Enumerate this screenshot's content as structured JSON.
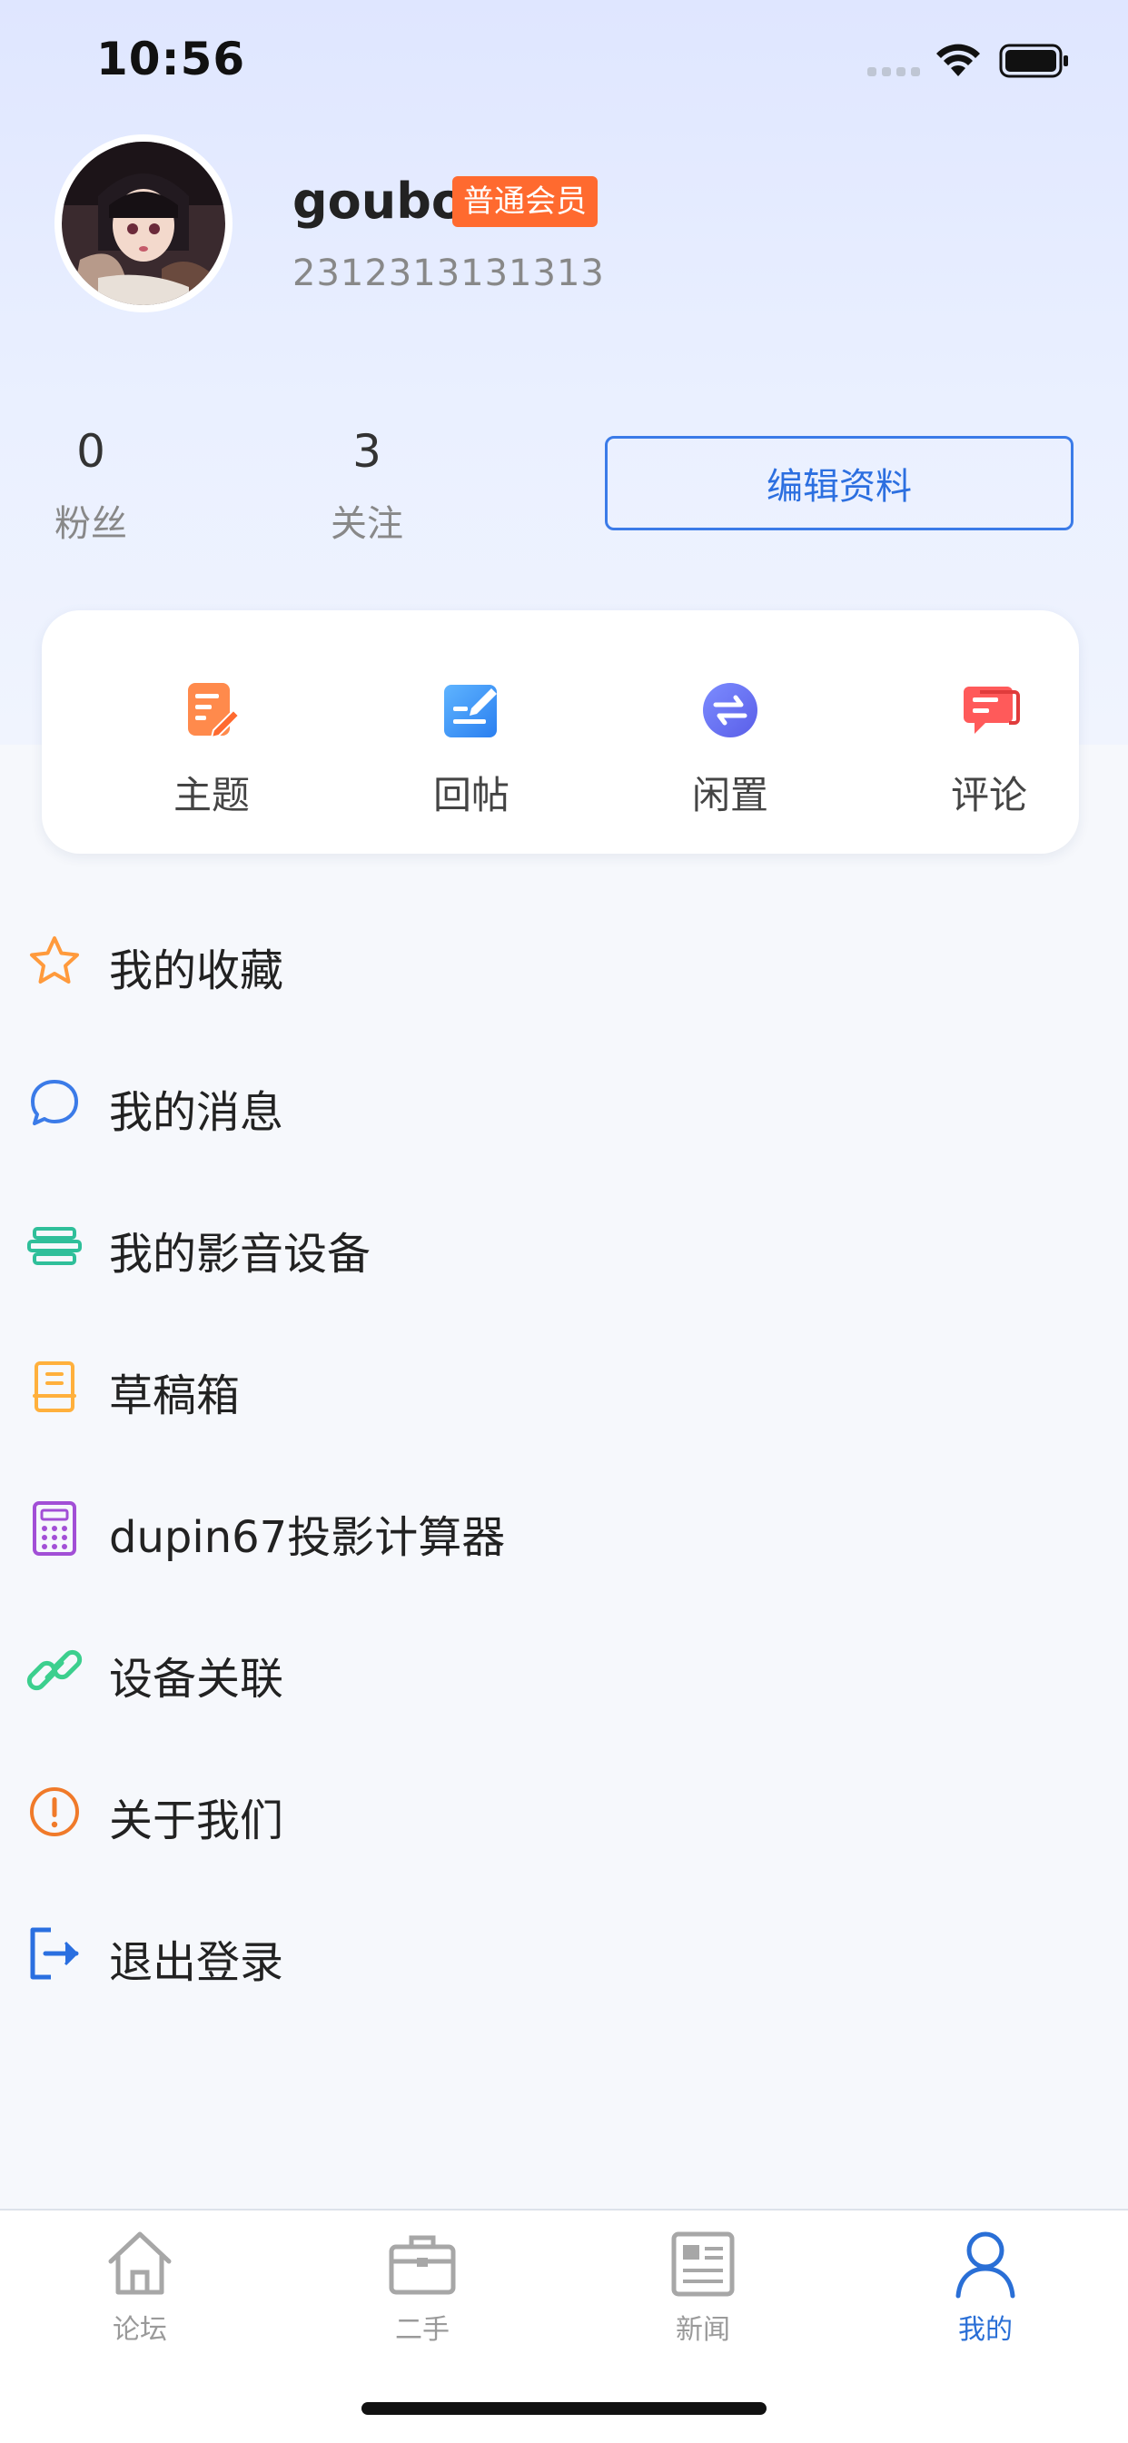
{
  "status_bar": {
    "time": "10:56"
  },
  "profile": {
    "username": "goubo",
    "member_badge": "普通会员",
    "user_id": "2312313131313"
  },
  "stats": [
    {
      "value": "0",
      "label": "粉丝"
    },
    {
      "value": "3",
      "label": "关注"
    }
  ],
  "edit_profile_label": "编辑资料",
  "actions": [
    {
      "label": "主题",
      "icon": "edit-note-icon"
    },
    {
      "label": "回帖",
      "icon": "reply-icon"
    },
    {
      "label": "闲置",
      "icon": "exchange-icon"
    },
    {
      "label": "评论",
      "icon": "comment-icon"
    }
  ],
  "menu": [
    {
      "label": "我的收藏",
      "icon": "star-icon"
    },
    {
      "label": "我的消息",
      "icon": "message-icon"
    },
    {
      "label": "我的影音设备",
      "icon": "av-device-icon"
    },
    {
      "label": "草稿箱",
      "icon": "drafts-icon"
    },
    {
      "label": "dupin67投影计算器",
      "icon": "calculator-icon"
    },
    {
      "label": "设备关联",
      "icon": "link-icon"
    },
    {
      "label": "关于我们",
      "icon": "info-icon"
    },
    {
      "label": "退出登录",
      "icon": "logout-icon"
    }
  ],
  "tabs": [
    {
      "label": "论坛",
      "icon": "home-icon",
      "active": false
    },
    {
      "label": "二手",
      "icon": "briefcase-icon",
      "active": false
    },
    {
      "label": "新闻",
      "icon": "newspaper-icon",
      "active": false
    },
    {
      "label": "我的",
      "icon": "user-icon",
      "active": true
    }
  ],
  "colors": {
    "accent": "#2c6fe0",
    "badge": "#ff6a2f",
    "header_bg": "#dfe6ff"
  }
}
